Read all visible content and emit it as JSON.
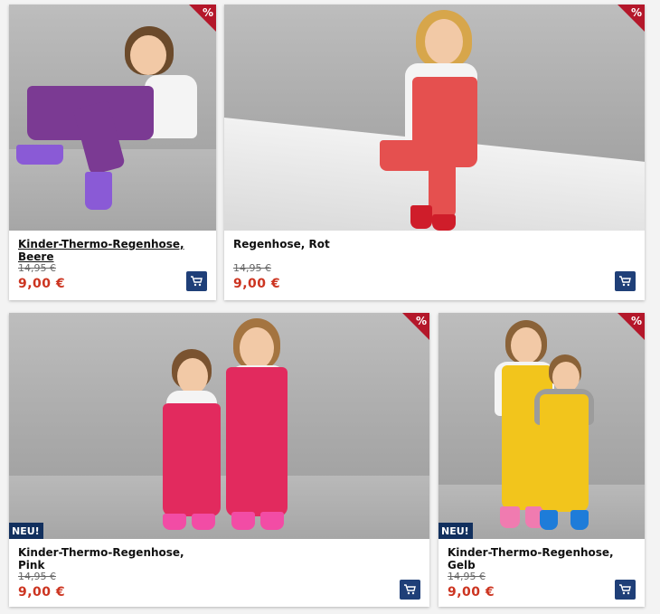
{
  "badges": {
    "sale": "%",
    "new": "NEU!"
  },
  "products": [
    {
      "title_line1": "Kinder-Thermo-Regenhose,",
      "title_line2": "Beere",
      "old_price": "14,95 €",
      "new_price": "9,00 €",
      "color": "#7b3a93",
      "cart_icon": "shopping-cart-icon"
    },
    {
      "title_line1": "Regenhose, Rot",
      "title_line2": "",
      "old_price": "14,95 €",
      "new_price": "9,00 €",
      "color": "#e5504f",
      "cart_icon": "shopping-cart-icon"
    },
    {
      "title_line1": "Kinder-Thermo-Regenhose,",
      "title_line2": "Pink",
      "old_price": "14,95 €",
      "new_price": "9,00 €",
      "color": "#e22a5e",
      "cart_icon": "shopping-cart-icon"
    },
    {
      "title_line1": "Kinder-Thermo-Regenhose,",
      "title_line2": "Gelb",
      "old_price": "14,95 €",
      "new_price": "9,00 €",
      "color": "#f2c51c",
      "cart_icon": "shopping-cart-icon"
    }
  ]
}
